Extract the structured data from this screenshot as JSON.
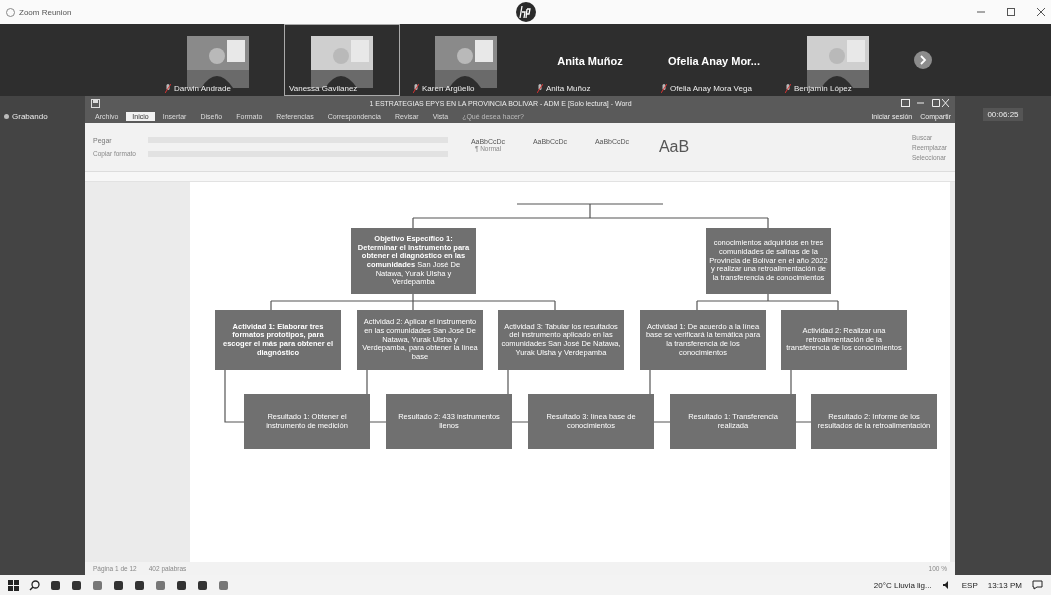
{
  "window": {
    "title": "Zoom Reunion"
  },
  "participants": [
    {
      "name": "Darwin Andrade",
      "kind": "video",
      "muted": true,
      "selected": false
    },
    {
      "name": "Vanessa Gavilanez",
      "kind": "video",
      "muted": false,
      "selected": true
    },
    {
      "name": "Karen Argüello",
      "kind": "video",
      "muted": true,
      "selected": false
    },
    {
      "name": "Anita Muñoz",
      "display": "Anita Muñoz",
      "kind": "name",
      "muted": true,
      "selected": false
    },
    {
      "name": "Ofelia Anay Mora Vega",
      "display": "Ofelia Anay Mor...",
      "kind": "name",
      "muted": true,
      "selected": false
    },
    {
      "name": "Benjamín López",
      "kind": "video",
      "muted": true,
      "selected": false
    }
  ],
  "recording": {
    "label": "Grabando"
  },
  "timer": "00:06:25",
  "word": {
    "title": "1 ESTRATEGIAS EPYS EN LA PROVINCIA BOLIVAR - ADM E [Solo lectura] - Word",
    "tabs": [
      {
        "label": "Archivo",
        "selected": false
      },
      {
        "label": "Inicio",
        "selected": true
      },
      {
        "label": "Insertar",
        "selected": false
      },
      {
        "label": "Diseño",
        "selected": false
      },
      {
        "label": "Formato",
        "selected": false
      },
      {
        "label": "Referencias",
        "selected": false
      },
      {
        "label": "Correspondencia",
        "selected": false
      },
      {
        "label": "Revisar",
        "selected": false
      },
      {
        "label": "Vista",
        "selected": false
      }
    ],
    "tell_me": "¿Qué desea hacer?",
    "sign_in": "Iniciar sesión",
    "share": "Compartir",
    "ribbon": {
      "paste": "Pegar",
      "copy_format": "Copiar formato",
      "styles": [
        {
          "preview": "AaBbCcDc",
          "label": "¶ Normal",
          "large": false
        },
        {
          "preview": "AaBbCcDc",
          "large": false
        },
        {
          "preview": "AaBbCcDc",
          "large": false
        },
        {
          "preview": "AaB",
          "large": true
        }
      ],
      "editing": [
        "Buscar",
        "Reemplazar",
        "Seleccionar"
      ]
    },
    "diagram": {
      "objectives": [
        {
          "text": "**Objetivo Específico 1: Determinar el instrumento para obtener el diagnóstico en las comunidades** San José De Natawa, Yurak Ulsha y Verdepamba"
        },
        {
          "text": "conocimientos adquiridos en tres comunidades de salinas de la Provincia de Bolívar en el año 2022 y realizar una retroalimentación de la transferencia de conocimientos"
        }
      ],
      "activities": [
        {
          "text": "Actividad 1: Elaborar tres formatos prototipos, para escoger el más para obtener el diagnóstico",
          "bold": true
        },
        {
          "text": "Actividad 2: Aplicar el instrumento en las comunidades San José De Natawa, Yurak Ulsha y Verdepamba, para obtener la línea base",
          "bold": false
        },
        {
          "text": "Actividad 3: Tabular los resultados del instrumento aplicado en las comunidades San José De Natawa, Yurak Ulsha y Verdepamba",
          "bold": false
        },
        {
          "text": "Actividad 1: De acuerdo a la línea base se verificará la temática para la transferencia de los conocimientos",
          "bold": false
        },
        {
          "text": "Actividad 2: Realizar una retroalimentación de la transferencia de los conocimientos",
          "bold": false
        }
      ],
      "results": [
        {
          "text": "Resultado 1: Obtener el instrumento de medición"
        },
        {
          "text": "Resultado 2: 433 instrumentos llenos"
        },
        {
          "text": "Resultado 3: línea base de conocimientos"
        },
        {
          "text": "Resultado 1: Transferencia realizada"
        },
        {
          "text": "Resultado 2: Informe de los resultados de la retroalimentación"
        }
      ]
    },
    "status_bar": {
      "page": "Página 1 de 12",
      "words": "402 palabras",
      "zoom": "100 %"
    }
  },
  "taskbar": {
    "weather": "20°C Lluvia lig...",
    "language": "ESP",
    "time": "13:13 PM"
  }
}
